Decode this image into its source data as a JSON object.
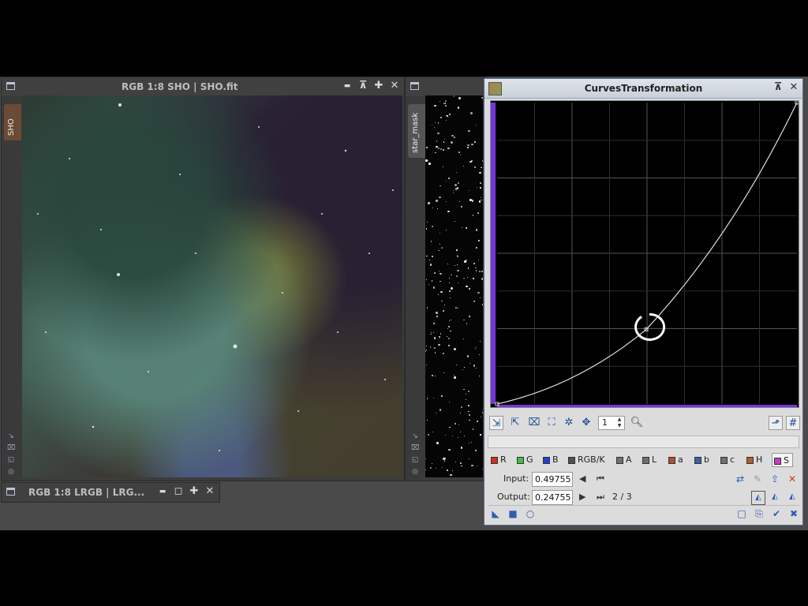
{
  "windows": {
    "sho": {
      "title": "RGB 1:8 SHO | SHO.fit",
      "tab": "SHO"
    },
    "star_mask": {
      "tab": "star_mask"
    },
    "lrgb_min": {
      "title": "RGB 1:8 LRGB | LRG..."
    }
  },
  "window_buttons": {
    "minimize": "▬",
    "shade": "⊼",
    "maximize": "✚",
    "close": "✕",
    "restore": "◻"
  },
  "curves": {
    "title": "CurvesTransformation",
    "zoom_value": "1",
    "channels": [
      {
        "label": "R",
        "color": "#d03020"
      },
      {
        "label": "G",
        "color": "#40c040"
      },
      {
        "label": "B",
        "color": "#2040d0"
      },
      {
        "label": "RGB/K",
        "color": "#505050"
      },
      {
        "label": "A",
        "color": "#707070"
      },
      {
        "label": "L",
        "color": "#707070"
      },
      {
        "label": "a",
        "color": "#b05030"
      },
      {
        "label": "b",
        "color": "#4060a0"
      },
      {
        "label": "c",
        "color": "#707070"
      },
      {
        "label": "H",
        "color": "#b06030"
      },
      {
        "label": "S",
        "color": "#c040c0",
        "selected": true
      }
    ],
    "input_label": "Input:",
    "input_value": "0.49755",
    "output_label": "Output:",
    "output_value": "0.24755",
    "point_index": "2 / 3",
    "curve_points": [
      [
        0,
        0
      ],
      [
        0.49755,
        0.24755
      ],
      [
        1,
        1
      ]
    ],
    "accent_color": "#8a40ff"
  }
}
